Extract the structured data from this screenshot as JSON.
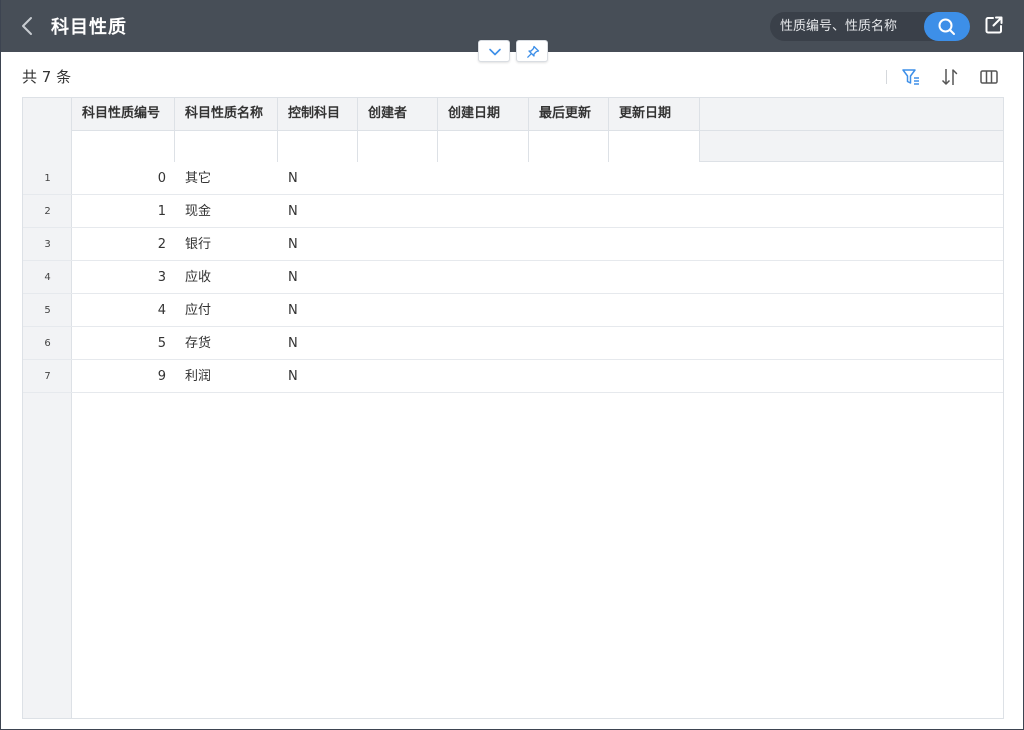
{
  "header": {
    "title": "科目性质",
    "search_placeholder": "性质编号、性质名称"
  },
  "summary": {
    "total_label": "共 7 条"
  },
  "table": {
    "columns": [
      {
        "label": "科目性质编号"
      },
      {
        "label": "科目性质名称"
      },
      {
        "label": "控制科目"
      },
      {
        "label": "创建者"
      },
      {
        "label": "创建日期"
      },
      {
        "label": "最后更新"
      },
      {
        "label": "更新日期"
      }
    ],
    "rows": [
      {
        "index": "1",
        "code": "0",
        "name": "其它",
        "control": "N"
      },
      {
        "index": "2",
        "code": "1",
        "name": "现金",
        "control": "N"
      },
      {
        "index": "3",
        "code": "2",
        "name": "银行",
        "control": "N"
      },
      {
        "index": "4",
        "code": "3",
        "name": "应收",
        "control": "N"
      },
      {
        "index": "5",
        "code": "4",
        "name": "应付",
        "control": "N"
      },
      {
        "index": "6",
        "code": "5",
        "name": "存货",
        "control": "N"
      },
      {
        "index": "7",
        "code": "9",
        "name": "利润",
        "control": "N"
      }
    ]
  },
  "icons": {
    "back": "chevron-left-icon",
    "search": "search-icon",
    "export": "external-link-icon",
    "collapse": "chevron-down-icon",
    "pin": "pin-icon",
    "filter": "filter-icon",
    "sort": "sort-icon",
    "columns": "columns-icon"
  },
  "colors": {
    "header_bg": "#474e57",
    "accent": "#3d8fe8",
    "grid_header_bg": "#f2f3f5"
  }
}
